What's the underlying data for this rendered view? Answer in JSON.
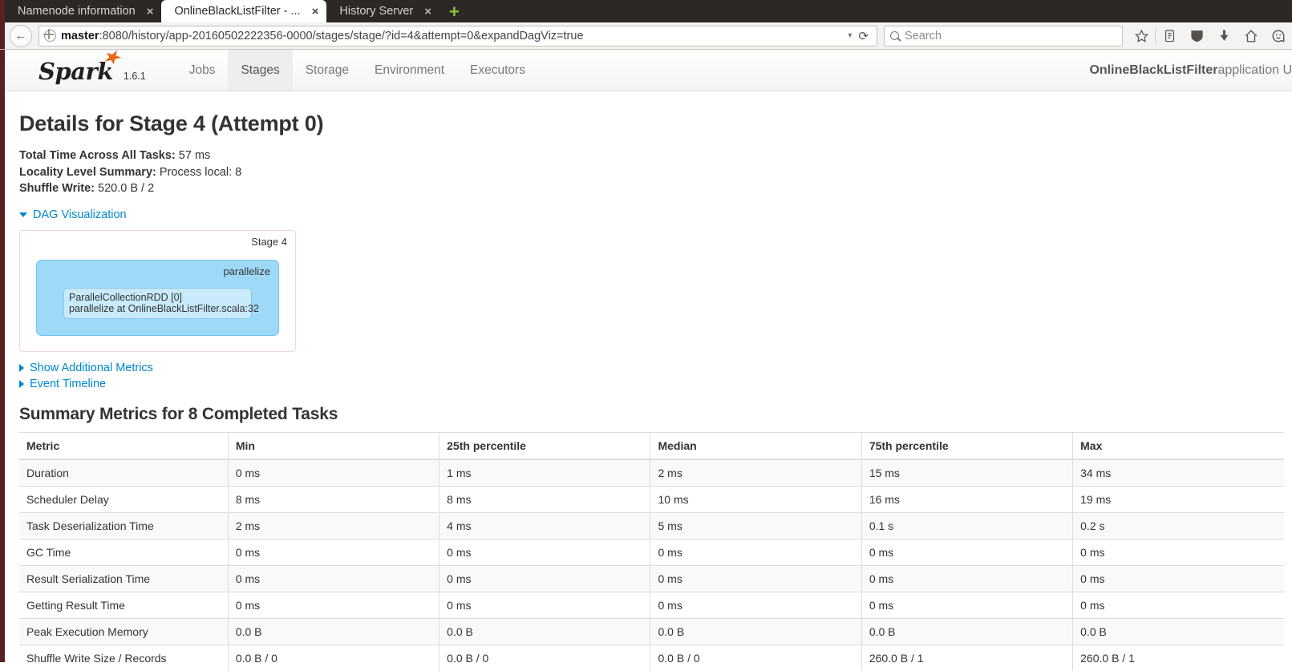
{
  "browser": {
    "tabs": [
      {
        "title": "Namenode information",
        "active": false,
        "close_label": "×"
      },
      {
        "title": "OnlineBlackListFilter - ...",
        "active": true,
        "close_label": "×"
      },
      {
        "title": "History Server",
        "active": false,
        "close_label": "×"
      }
    ],
    "new_tab_label": "+",
    "back_glyph": "←",
    "url_host": "master",
    "url_rest": ":8080/history/app-20160502222356-0000/stages/stage/?id=4&attempt=0&expandDagViz=true",
    "url_full": "master:8080/history/app-20160502222356-0000/stages/stage/?id=4&attempt=0&expandDagViz=true",
    "url_dropdown_glyph": "▾",
    "reload_glyph": "⟳",
    "search_placeholder": "Search",
    "search_value": "",
    "toolbar_icons": [
      "bookmark-star-icon",
      "reading-list-icon",
      "shield-icon",
      "downloads-icon",
      "home-icon",
      "sync-smiley-icon"
    ]
  },
  "spark": {
    "brand_name": "Spark",
    "version": "1.6.1",
    "nav_items": [
      {
        "label": "Jobs",
        "active": false
      },
      {
        "label": "Stages",
        "active": true
      },
      {
        "label": "Storage",
        "active": false
      },
      {
        "label": "Environment",
        "active": false
      },
      {
        "label": "Executors",
        "active": false
      }
    ],
    "app_name": "OnlineBlackListFilter",
    "app_suffix": " application U"
  },
  "main": {
    "page_title": "Details for Stage 4 (Attempt 0)",
    "summary": [
      {
        "label": "Total Time Across All Tasks:",
        "value": "57 ms"
      },
      {
        "label": "Locality Level Summary:",
        "value": "Process local: 8"
      },
      {
        "label": "Shuffle Write:",
        "value": "520.0 B / 2"
      }
    ],
    "dag_toggle_label": "DAG Visualization",
    "dag": {
      "stage_label": "Stage 4",
      "cluster_label": "parallelize",
      "node_line1": "ParallelCollectionRDD [0]",
      "node_line2": "parallelize at OnlineBlackListFilter.scala:32"
    },
    "show_additional_metrics_label": "Show Additional Metrics",
    "event_timeline_label": "Event Timeline",
    "summary_metrics_heading": "Summary Metrics for 8 Completed Tasks",
    "table": {
      "columns": [
        "Metric",
        "Min",
        "25th percentile",
        "Median",
        "75th percentile",
        "Max"
      ],
      "rows": [
        [
          "Duration",
          "0 ms",
          "1 ms",
          "2 ms",
          "15 ms",
          "34 ms"
        ],
        [
          "Scheduler Delay",
          "8 ms",
          "8 ms",
          "10 ms",
          "16 ms",
          "19 ms"
        ],
        [
          "Task Deserialization Time",
          "2 ms",
          "4 ms",
          "5 ms",
          "0.1 s",
          "0.2 s"
        ],
        [
          "GC Time",
          "0 ms",
          "0 ms",
          "0 ms",
          "0 ms",
          "0 ms"
        ],
        [
          "Result Serialization Time",
          "0 ms",
          "0 ms",
          "0 ms",
          "0 ms",
          "0 ms"
        ],
        [
          "Getting Result Time",
          "0 ms",
          "0 ms",
          "0 ms",
          "0 ms",
          "0 ms"
        ],
        [
          "Peak Execution Memory",
          "0.0 B",
          "0.0 B",
          "0.0 B",
          "0.0 B",
          "0.0 B"
        ],
        [
          "Shuffle Write Size / Records",
          "0.0 B / 0",
          "0.0 B / 0",
          "0.0 B / 0",
          "260.0 B / 1",
          "260.0 B / 1"
        ]
      ]
    }
  },
  "colors": {
    "link": "#0088cc",
    "accent_orange": "#e8661a",
    "dag_cluster_fill": "#9ed9f7",
    "dag_node_fill": "#c8eafb",
    "dag_border_pink": "#f0d8d8",
    "chrome_dark": "#2b2825",
    "chrome_maroon": "#5a1f22"
  }
}
